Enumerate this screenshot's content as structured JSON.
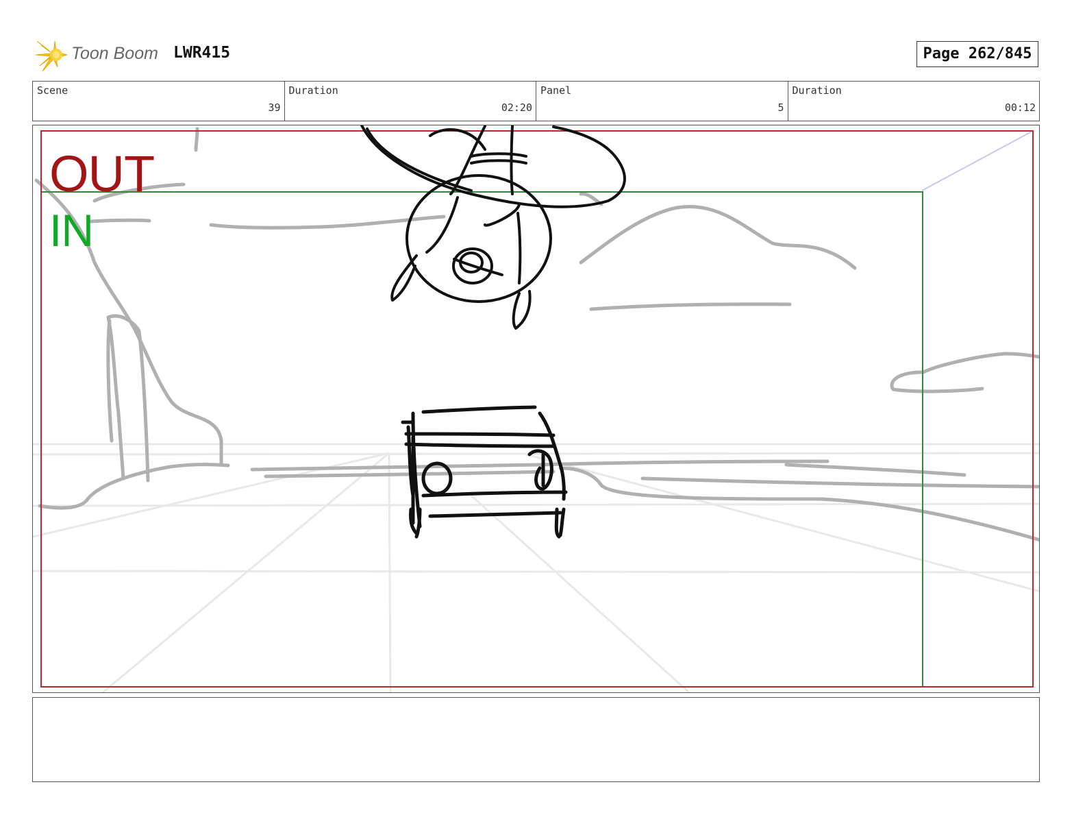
{
  "header": {
    "logo_text": "Toon Boom",
    "project_code": "LWR415",
    "page_label": "Page 262/845"
  },
  "info": {
    "scene_label": "Scene",
    "scene_value": "39",
    "scene_duration_label": "Duration",
    "scene_duration_value": "02:20",
    "panel_label": "Panel",
    "panel_value": "5",
    "panel_duration_label": "Duration",
    "panel_duration_value": "00:12"
  },
  "panel": {
    "out_label": "OUT",
    "in_label": "IN",
    "colors": {
      "out_frame": "#c0262d",
      "in_frame": "#2e8b3a",
      "out_text": "#a31515",
      "in_text": "#13a825",
      "sketch_ink": "#111111",
      "background_sketch": "#b0b0b0",
      "perspective_guides": "#e8e8e8"
    }
  },
  "notes": {}
}
